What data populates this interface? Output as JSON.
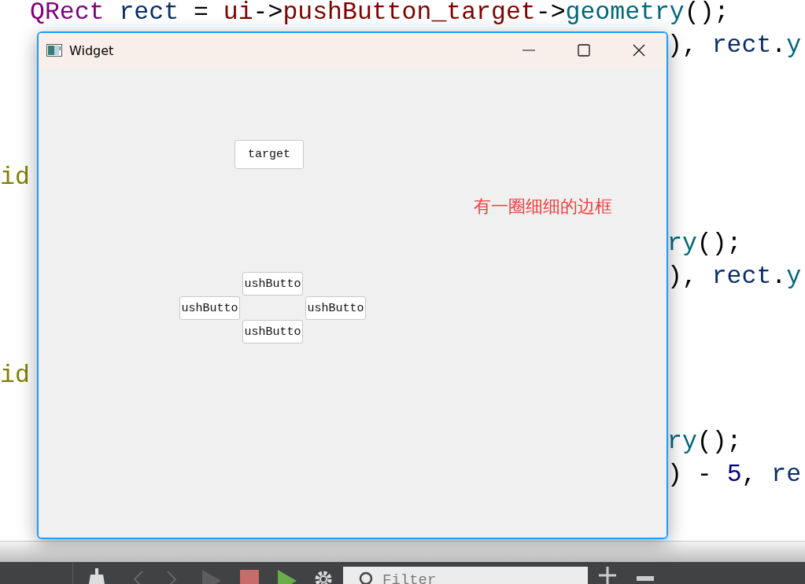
{
  "editor": {
    "lines": [
      {
        "kind": "indented",
        "left": [
          {
            "t": "QRect",
            "kind": "type"
          },
          {
            "t": " rect",
            "kind": "var"
          },
          {
            "t": " = ",
            "kind": "plain"
          },
          {
            "t": "ui",
            "kind": "member"
          },
          {
            "t": "->",
            "kind": "plain"
          },
          {
            "t": "pushButton_target",
            "kind": "member"
          },
          {
            "t": "->",
            "kind": "plain"
          },
          {
            "t": "geometry",
            "kind": "func"
          },
          {
            "t": "();",
            "kind": "plain"
          }
        ]
      },
      {
        "kind": "indented",
        "right": [
          {
            "t": "), ",
            "kind": "plain"
          },
          {
            "t": "rect",
            "kind": "var"
          },
          {
            "t": ".",
            "kind": "plain"
          },
          {
            "t": "y",
            "kind": "func"
          }
        ]
      },
      {
        "kind": "blank"
      },
      {
        "kind": "blank"
      },
      {
        "kind": "blank"
      },
      {
        "kind": "top",
        "left": [
          {
            "t": "id",
            "kind": "keyword"
          }
        ]
      },
      {
        "kind": "blank"
      },
      {
        "kind": "indented",
        "right": [
          {
            "t": "ry",
            "kind": "func"
          },
          {
            "t": "();",
            "kind": "plain"
          }
        ]
      },
      {
        "kind": "indented",
        "right": [
          {
            "t": "), ",
            "kind": "plain"
          },
          {
            "t": "rect",
            "kind": "var"
          },
          {
            "t": ".",
            "kind": "plain"
          },
          {
            "t": "y",
            "kind": "func"
          }
        ]
      },
      {
        "kind": "blank"
      },
      {
        "kind": "blank"
      },
      {
        "kind": "top",
        "left": [
          {
            "t": "id",
            "kind": "keyword"
          }
        ]
      },
      {
        "kind": "blank"
      },
      {
        "kind": "indented",
        "right": [
          {
            "t": "ry",
            "kind": "func"
          },
          {
            "t": "();",
            "kind": "plain"
          }
        ]
      },
      {
        "kind": "indented",
        "right": [
          {
            "t": ") - ",
            "kind": "plain"
          },
          {
            "t": "5",
            "kind": "number"
          },
          {
            "t": ", ",
            "kind": "plain"
          },
          {
            "t": "re",
            "kind": "var"
          }
        ]
      }
    ]
  },
  "window": {
    "title": "Widget",
    "buttons": [
      {
        "label": "target"
      },
      {
        "label": "ushButto"
      },
      {
        "label": "ushButto"
      },
      {
        "label": "ushButto"
      },
      {
        "label": "ushButto"
      }
    ],
    "note": "有一圈细细的边框"
  },
  "toolbar": {
    "filter": {
      "placeholder": "Filter"
    }
  }
}
